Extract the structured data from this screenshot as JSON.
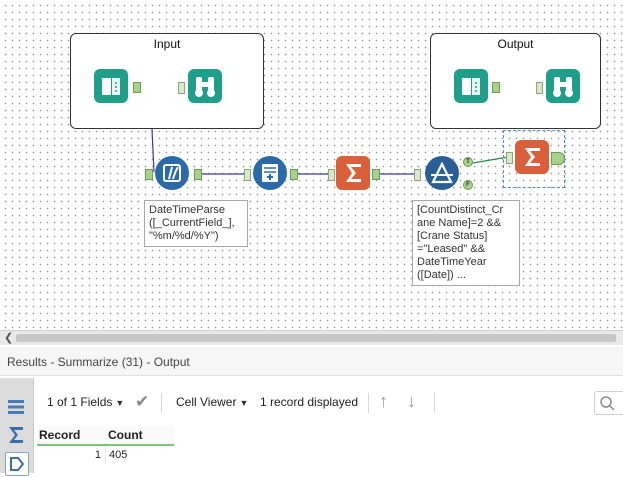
{
  "canvas": {
    "containers": {
      "input_title": "Input",
      "output_title": "Output"
    },
    "annotations": {
      "datetime": "DateTimeParse\n([_CurrentField_],\n\"%m/%d/%Y\")",
      "filter": "[CountDistinct_Cr\nane Name]=2 &&\n[Crane Status]\n=\"Leased\" &&\nDateTimeYear\n([Date]) ..."
    },
    "anchors": {
      "true": "T",
      "false": "F"
    },
    "tool_icons": [
      "input-data-icon",
      "browse-icon",
      "datetime-icon",
      "record-id-icon",
      "summarize-icon",
      "filter-icon"
    ],
    "colors": {
      "in_out": "#1f9e8a",
      "parse": "#2b6aa8",
      "summarize": "#d9603b",
      "filter": "#2a5f95",
      "anchor": "#a9d18e"
    }
  },
  "results": {
    "title": "Results - Summarize (31) - Output",
    "toolbar": {
      "fields": "1 of 1 Fields",
      "viewer": "Cell Viewer",
      "records": "1 record displayed"
    },
    "columns": [
      "Record",
      "Count"
    ],
    "rows": [
      {
        "record": "1",
        "count": "405"
      }
    ]
  }
}
